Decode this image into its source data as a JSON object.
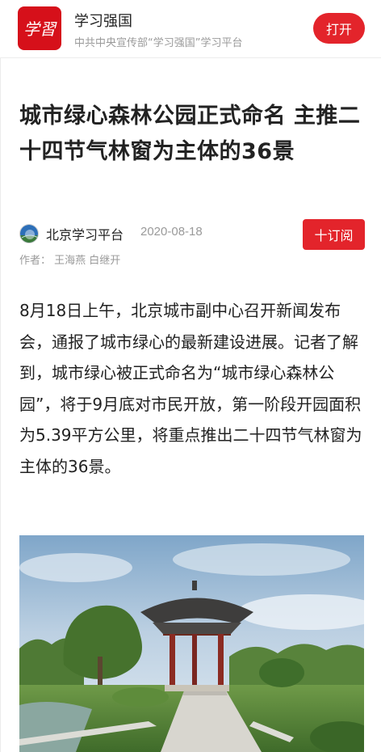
{
  "banner": {
    "logo_icon": "xuexi-logo-icon",
    "logo_text": "学習",
    "app_name": "学习强国",
    "app_subtitle": "中共中央宣传部“学习强国”学习平台",
    "open_label": "打开",
    "accent": "#e3242b"
  },
  "article": {
    "title": "城市绿心森林公园正式命名 主推二十四节气林窗为主体的36景",
    "source": "北京学习平台",
    "date": "2020-08-18",
    "subscribe_label": "十订阅",
    "authors": "作者：  王海燕 白继开",
    "body": "8月18日上午，北京城市副中心召开新闻发布会，通报了城市绿心的最新建设进展。记者了解到，城市绿心被正式命名为“城市绿心森林公园”，将于9月底对市民开放，第一阶段开园面积为5.39平方公里，将重点推出二十四节气林窗为主体的36景。",
    "avatar_icon": "globe-avatar-icon",
    "photo": "park-pavilion-photo"
  }
}
